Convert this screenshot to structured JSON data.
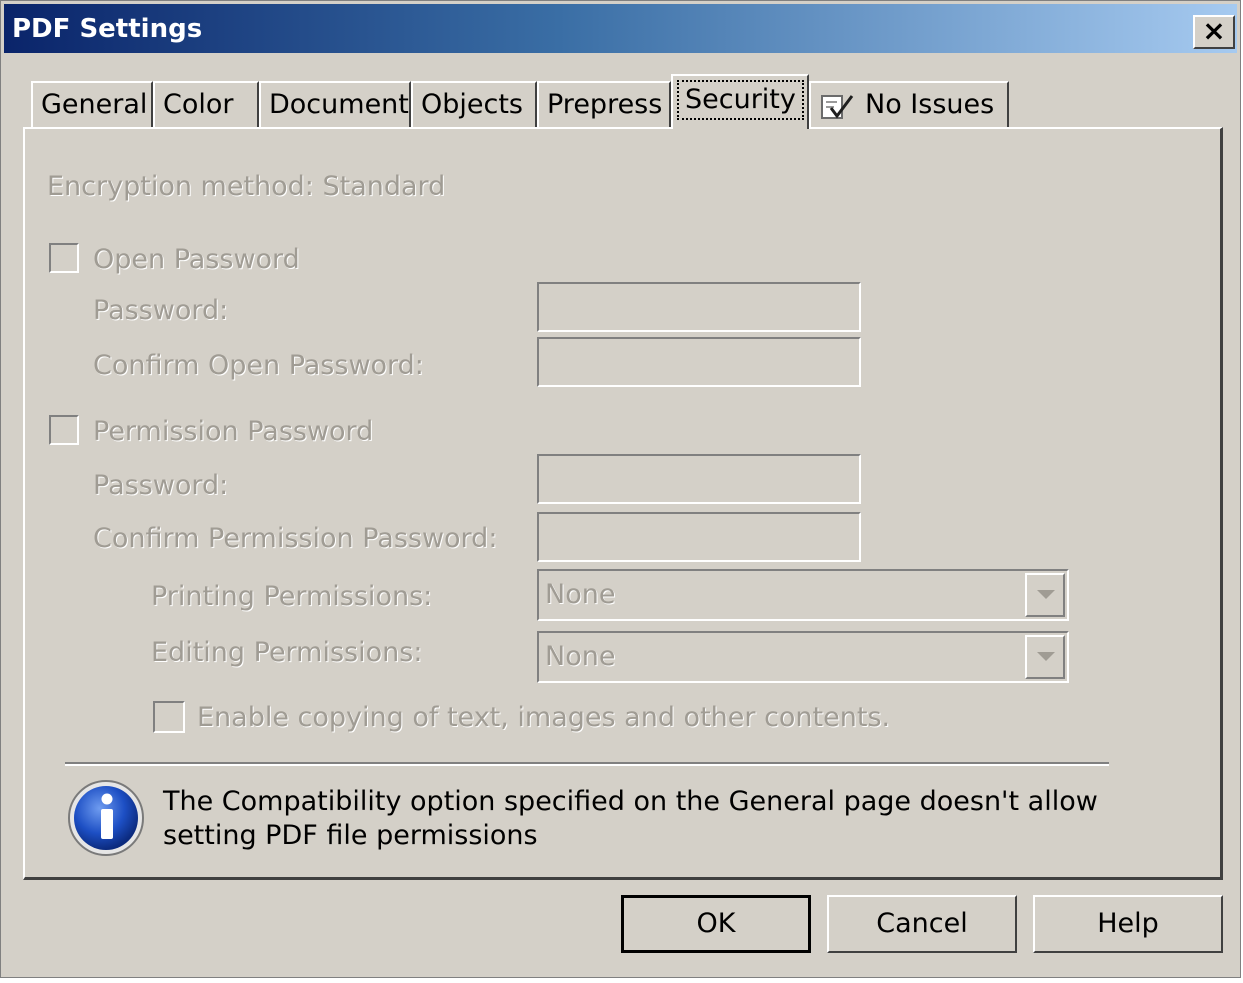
{
  "window": {
    "title": "PDF Settings",
    "close_label": "×"
  },
  "tabs": [
    {
      "label": "General"
    },
    {
      "label": "Color"
    },
    {
      "label": "Document"
    },
    {
      "label": "Objects"
    },
    {
      "label": "Prepress"
    },
    {
      "label": "Security",
      "active": true
    },
    {
      "label": "No Issues",
      "icon": "check-document-icon"
    }
  ],
  "security": {
    "encryption_label": "Encryption method: Standard",
    "open_password": {
      "checkbox_label": "Open Password",
      "checked": false,
      "password_label": "Password:",
      "confirm_label": "Confirm Open Password:",
      "password_value": "",
      "confirm_value": ""
    },
    "permission_password": {
      "checkbox_label": "Permission Password",
      "checked": false,
      "password_label": "Password:",
      "confirm_label": "Confirm Permission Password:",
      "password_value": "",
      "confirm_value": ""
    },
    "printing_permissions": {
      "label": "Printing Permissions:",
      "value": "None"
    },
    "editing_permissions": {
      "label": "Editing Permissions:",
      "value": "None"
    },
    "enable_copying": {
      "label": "Enable copying of text, images and other contents.",
      "checked": false
    }
  },
  "info": {
    "icon": "info-icon",
    "message": "The Compatibility option specified on the General page doesn't allow setting PDF file permissions",
    "colors": {
      "icon_blue": "#1d4fc4",
      "title_gradient_start": "#0a246a",
      "title_gradient_end": "#a6caf0",
      "disabled_text": "#a09c94"
    }
  },
  "buttons": {
    "ok": "OK",
    "cancel": "Cancel",
    "help": "Help"
  }
}
